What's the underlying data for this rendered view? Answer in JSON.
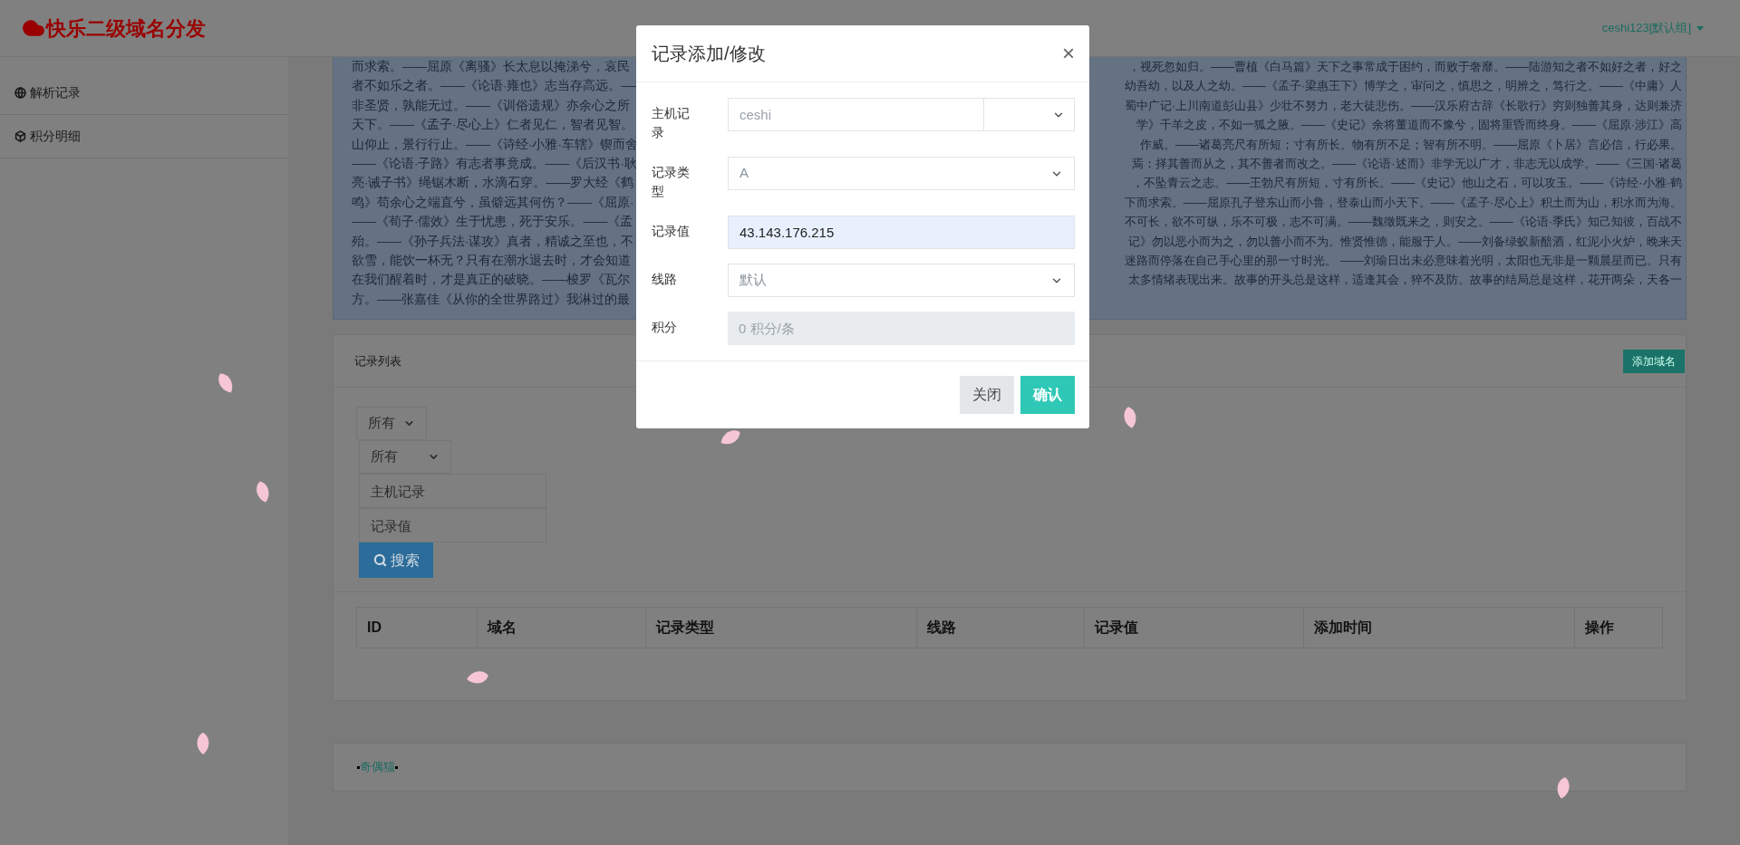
{
  "header": {
    "logo": "快乐二级域名分发",
    "user": "ceshi123[默认组]"
  },
  "sidebar": {
    "items": [
      {
        "label": "解析记录"
      },
      {
        "label": "积分明细"
      }
    ]
  },
  "quotes": {
    "left": [
      "而求索。——屈原《离骚》长太息以掩涕兮，哀民",
      "者不如乐之者。——《论语·雍也》志当存高远。——",
      "非圣贤，孰能无过。——《训俗遗规》亦余心之所",
      "天下。——《孟子·尽心上》仁者见仁，智者见智。",
      "山仰止，景行行止。——《诗经·小雅·车辖》锲而舍",
      "——《论语·子路》有志者事竟成。——《后汉书·耿",
      "亮·诫子书》绳锯木断，水滴石穿。——罗大经《鹤",
      "鸣》苟余心之端直兮，虽僻远其何伤？——《屈原·",
      "——《荀子·儒效》生于忧患，死于安乐。——《孟",
      "殆。——《孙子兵法·谋攻》真者，精诚之至也，不",
      "欲雪，能饮一杯无？只有在潮水退去时，才会知道",
      "在我们醒着时，才是真正的破晓。——梭罗《瓦尔",
      "方。——张嘉佳《从你的全世界路过》我淋过的最"
    ],
    "right": [
      "，视死忽如归。——曹植《白马篇》天下之事常成于困约，而败于奢靡。——陆游知之者不如好之者，好之",
      "幼吾幼，以及人之幼。——《孟子·梁惠王下》博学之，审问之，慎思之，明辨之，笃行之。——《中庸》人",
      "蜀中广记·上川南道彭山县》少壮不努力，老大徒悲伤。——汉乐府古辞《长歌行》穷则独善其身，达则兼济",
      "学》千羊之皮，不如一狐之腋。——《史记》余将董道而不豫兮，固将重昏而终身。——《屈原·涉江》高",
      "作威。——诸葛亮尺有所短；寸有所长。物有所不足；智有所不明。——屈原《卜居》言必信，行必果。",
      "焉：择其善而从之，其不善者而改之。——《论语·述而》非学无以广才，非志无以成学。——《三国·诸葛",
      "，不坠青云之志。——王勃尺有所短，寸有所长。——《史记》他山之石，可以攻玉。——《诗经·小雅·鹤",
      "下而求索。——屈原孔子登东山而小鲁，登泰山而小天下。——《孟子·尽心上》积土而为山，积水而为海。",
      "不可长，欲不可纵，乐不可极，志不可满。——魏徵既来之，则安之。——《论语·季氏》知己知彼，百战不",
      "记》勿以恶小而为之，勿以善小而不为。惟贤惟德，能服于人。——刘备绿蚁新醅酒，红泥小火炉，晚来天",
      "迷路而停落在自己手心里的那一寸时光。 ——刘瑜日出未必意味着光明，太阳也无非是一颗晨星而已。只有",
      "太多情绪表现出来。故事的开头总是这样，适逢其会，猝不及防。故事的结局总是这样，花开两朵，天各一"
    ]
  },
  "record_list": {
    "title": "记录列表",
    "add_button": "添加域名",
    "filters": [
      {
        "kind": "select",
        "value": "所有"
      },
      {
        "kind": "select",
        "value": "所有"
      },
      {
        "kind": "input",
        "placeholder": "主机记录"
      },
      {
        "kind": "input",
        "placeholder": "记录值"
      }
    ],
    "search_button": "搜索",
    "columns": [
      "ID",
      "域名",
      "记录类型",
      "线路",
      "记录值",
      "添加时间",
      "操作"
    ]
  },
  "footer": {
    "link": "奇偶猫"
  },
  "modal": {
    "title": "记录添加/修改",
    "close": "×",
    "fields": [
      {
        "label": "主机记录",
        "kind": "input_select",
        "placeholder": "ceshi"
      },
      {
        "label": "记录类型",
        "kind": "select",
        "value": "A"
      },
      {
        "label": "记录值",
        "kind": "input",
        "value": "43.143.176.215"
      },
      {
        "label": "线路",
        "kind": "select",
        "value": "默认"
      },
      {
        "label": "积分",
        "kind": "readonly",
        "placeholder": "0 积分/条"
      }
    ],
    "buttons": [
      {
        "label": "关闭",
        "kind": "secondary"
      },
      {
        "label": "确认",
        "kind": "primary"
      }
    ]
  }
}
